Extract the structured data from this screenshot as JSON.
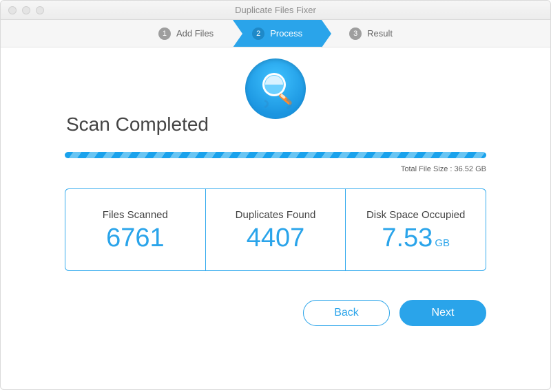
{
  "window": {
    "title": "Duplicate Files Fixer"
  },
  "steps": {
    "s1": {
      "num": "1",
      "label": "Add Files"
    },
    "s2": {
      "num": "2",
      "label": "Process"
    },
    "s3": {
      "num": "3",
      "label": "Result"
    }
  },
  "main": {
    "heading": "Scan Completed",
    "total_label": "Total File Size : 36.52 GB"
  },
  "stats": {
    "files_scanned": {
      "label": "Files Scanned",
      "value": "6761"
    },
    "duplicates_found": {
      "label": "Duplicates Found",
      "value": "4407"
    },
    "disk_space": {
      "label": "Disk Space Occupied",
      "value": "7.53",
      "unit": "GB"
    }
  },
  "actions": {
    "back": "Back",
    "next": "Next"
  },
  "colors": {
    "accent": "#2aa4ea"
  }
}
